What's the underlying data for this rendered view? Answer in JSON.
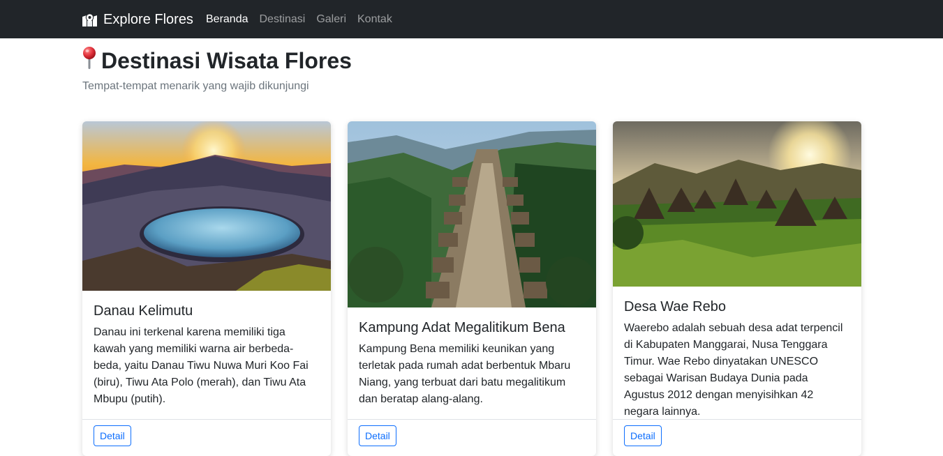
{
  "navbar": {
    "brand": "Explore Flores",
    "brand_icon": "map-icon",
    "links": [
      {
        "label": "Beranda",
        "active": true
      },
      {
        "label": "Destinasi",
        "active": false
      },
      {
        "label": "Galeri",
        "active": false
      },
      {
        "label": "Kontak",
        "active": false
      }
    ]
  },
  "header": {
    "icon": "pin-icon",
    "title": "Destinasi Wisata Flores",
    "subtitle": "Tempat-tempat menarik yang wajib dikunjungi"
  },
  "cards": [
    {
      "title": "Danau Kelimutu",
      "text": "Danau ini terkenal karena memiliki tiga kawah yang memiliki warna air berbeda-beda, yaitu Danau Tiwu Nuwa Muri Koo Fai (biru), Tiwu Ata Polo (merah), dan Tiwu Ata Mbupu (putih).",
      "button": "Detail"
    },
    {
      "title": "Kampung Adat Megalitikum Bena",
      "text": "Kampung Bena memiliki keunikan yang terletak pada rumah adat berbentuk Mbaru Niang, yang terbuat dari batu megalitikum dan beratap alang-alang.",
      "button": "Detail"
    },
    {
      "title": "Desa Wae Rebo",
      "text": "Waerebo adalah sebuah desa adat terpencil di Kabupaten Manggarai, Nusa Tenggara Timur. Wae Rebo dinyatakan UNESCO sebagai Warisan Budaya Dunia pada Agustus 2012 dengan menyisihkan 42 negara lainnya.",
      "button": "Detail"
    }
  ],
  "colors": {
    "navbar_bg": "#212529",
    "primary": "#0d6efd",
    "muted": "#6c757d"
  }
}
